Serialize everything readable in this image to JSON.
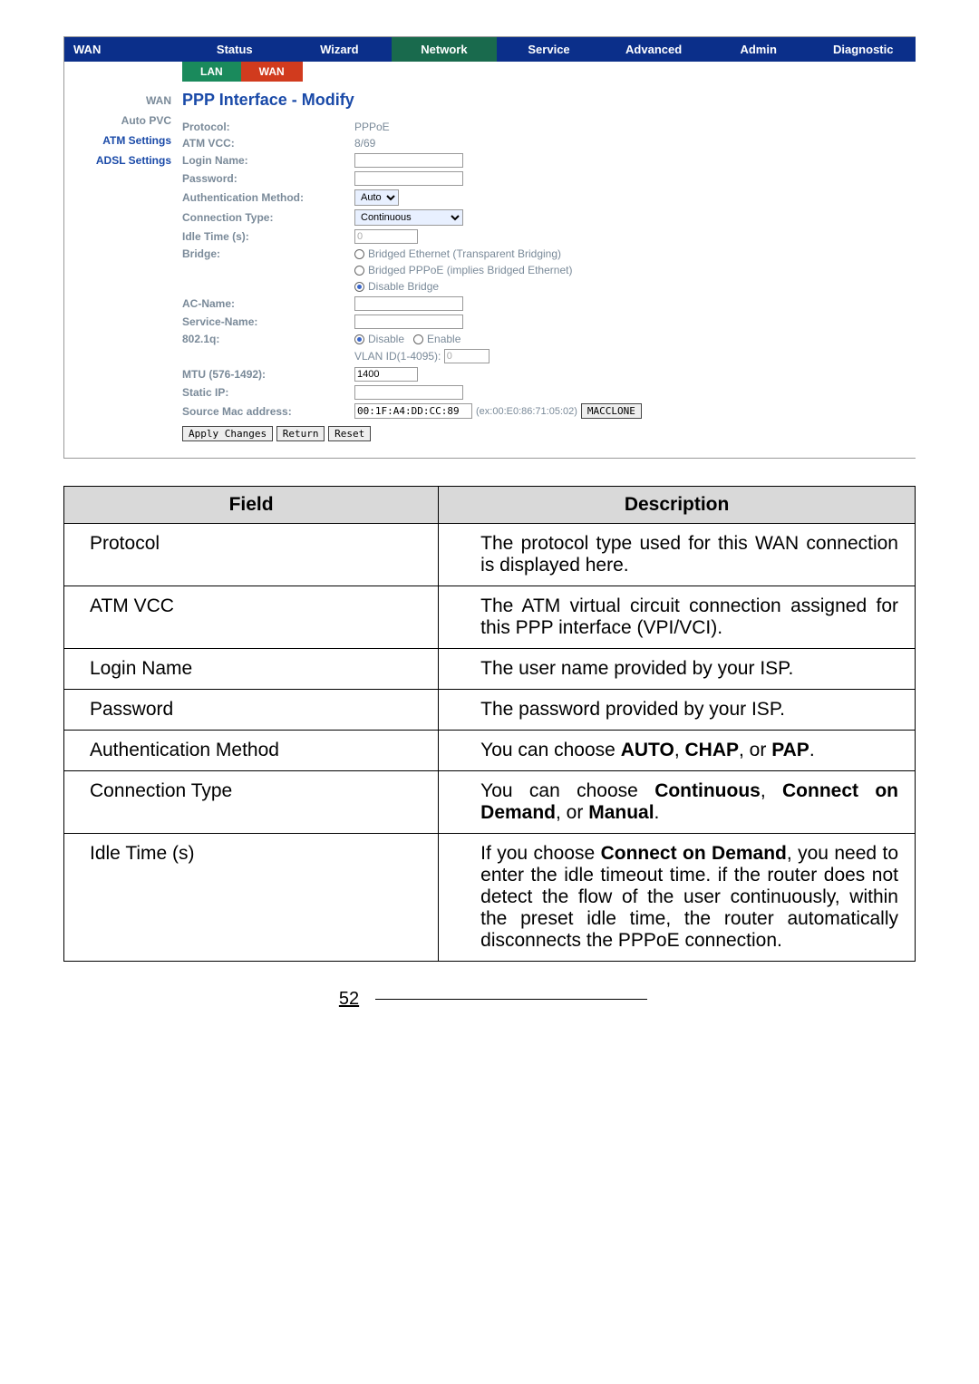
{
  "nav": {
    "wan_label": "WAN",
    "tabs": [
      "Status",
      "Wizard",
      "Network",
      "Service",
      "Advanced",
      "Admin",
      "Diagnostic"
    ],
    "subtabs": [
      "LAN",
      "WAN"
    ]
  },
  "sidebar": {
    "items": [
      "WAN",
      "Auto PVC",
      "ATM Settings",
      "ADSL Settings"
    ]
  },
  "form": {
    "title": "PPP Interface - Modify",
    "protocol_label": "Protocol:",
    "protocol_value": "PPPoE",
    "atmvcc_label": "ATM VCC:",
    "atmvcc_value": "8/69",
    "login_label": "Login Name:",
    "login_value": "",
    "password_label": "Password:",
    "password_value": "",
    "auth_label": "Authentication Method:",
    "auth_value": "Auto",
    "conn_label": "Connection Type:",
    "conn_value": "Continuous",
    "idle_label": "Idle Time (s):",
    "idle_value": "0",
    "bridge_label": "Bridge:",
    "bridge_opt1": "Bridged Ethernet (Transparent Bridging)",
    "bridge_opt2": "Bridged PPPoE (implies Bridged Ethernet)",
    "bridge_opt3": "Disable Bridge",
    "acname_label": "AC-Name:",
    "acname_value": "",
    "servicename_label": "Service-Name:",
    "servicename_value": "",
    "dot1q_label": "802.1q:",
    "dot1q_disable": "Disable",
    "dot1q_enable": "Enable",
    "vlan_label": "VLAN ID(1-4095):",
    "vlan_value": "0",
    "mtu_label": "MTU (576-1492):",
    "mtu_value": "1400",
    "staticip_label": "Static IP:",
    "staticip_value": "",
    "srcmac_label": "Source Mac address:",
    "srcmac_value": "00:1F:A4:DD:CC:89",
    "srcmac_example": "(ex:00:E0:86:71:05:02)",
    "macclone_btn": "MACCLONE",
    "apply_btn": "Apply Changes",
    "return_btn": "Return",
    "reset_btn": "Reset"
  },
  "table": {
    "h_field": "Field",
    "h_desc": "Description",
    "rows": [
      {
        "f": "Protocol",
        "d": "The protocol type used for this WAN connection is displayed here."
      },
      {
        "f": "ATM VCC",
        "d": "The ATM virtual circuit connection assigned for this PPP interface (VPI/VCI)."
      },
      {
        "f": "Login Name",
        "d": "The user name provided by your ISP."
      },
      {
        "f": "Password",
        "d": "The password provided by your ISP."
      },
      {
        "f": "Authentication Method",
        "d": "You can choose <b>AUTO</b>, <b>CHAP</b>, or <b>PAP</b>."
      },
      {
        "f": "Connection Type",
        "d": "You can choose <b>Continuous</b>, <b>Connect on Demand</b>, or <b>Manual</b>."
      },
      {
        "f": "Idle Time (s)",
        "d": "If you choose <b>Connect on Demand</b>, you need to enter the idle timeout time. if the router does not detect the flow of the user continuously, within the preset idle time, the router automatically disconnects the PPPoE connection."
      }
    ]
  },
  "page_number": "52"
}
